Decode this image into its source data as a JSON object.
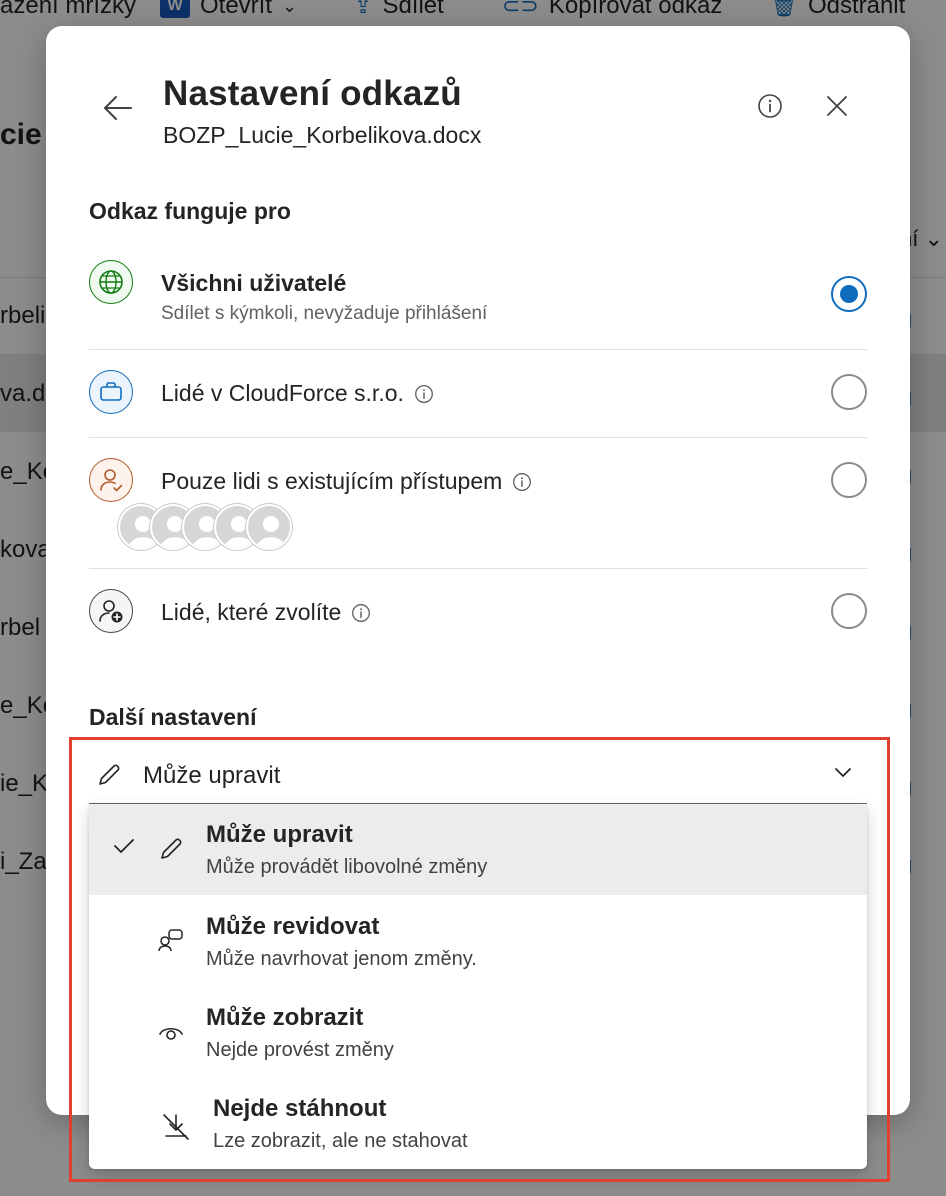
{
  "background": {
    "toolbar": {
      "grid_label": "azení mřížky",
      "open_label": "Otevřít",
      "share_label": "Sdílet",
      "copy_link_label": "Kopírovat odkaz",
      "delete_label": "Odstranit"
    },
    "page_title": "cie",
    "column_header": "ní",
    "rows": [
      "rbeli",
      "va.do",
      "e_Ko",
      "kova",
      "rbel",
      "e_Ko",
      "ie_Ko",
      "i_Zaz"
    ],
    "row_link": "g"
  },
  "dialog": {
    "title": "Nastavení odkazů",
    "filename": "BOZP_Lucie_Korbelikova.docx",
    "link_works_for": "Odkaz funguje pro",
    "options": [
      {
        "title": "Všichni uživatelé",
        "subtitle": "Sdílet s kýmkoli, nevyžaduje přihlášení",
        "icon": "globe-icon",
        "selected": true
      },
      {
        "title": "Lidé v CloudForce s.r.o.",
        "icon": "briefcase-icon",
        "selected": false
      },
      {
        "title": "Pouze lidi s existujícím přístupem",
        "icon": "person-access-icon",
        "selected": false
      },
      {
        "title": "Lidé, které zvolíte",
        "icon": "person-add-icon",
        "selected": false
      }
    ],
    "more_settings": "Další nastavení",
    "permission": {
      "value": "Může upravit",
      "menu": [
        {
          "title": "Může upravit",
          "subtitle": "Může provádět libovolné změny",
          "icon": "pencil-icon",
          "selected": true
        },
        {
          "title": "Může revidovat",
          "subtitle": "Může navrhovat jenom změny.",
          "icon": "review-icon",
          "selected": false
        },
        {
          "title": "Může zobrazit",
          "subtitle": "Nejde provést změny",
          "icon": "eye-icon",
          "selected": false
        },
        {
          "title": "Nejde stáhnout",
          "subtitle": "Lze zobrazit, ale ne stahovat",
          "icon": "no-download-icon",
          "selected": false
        }
      ]
    }
  },
  "colors": {
    "accent": "#0f6cbd",
    "highlight": "#e0402d",
    "globe": "#107c10",
    "briefcase": "#0f6cbd",
    "person_access": "#b35a2c"
  }
}
